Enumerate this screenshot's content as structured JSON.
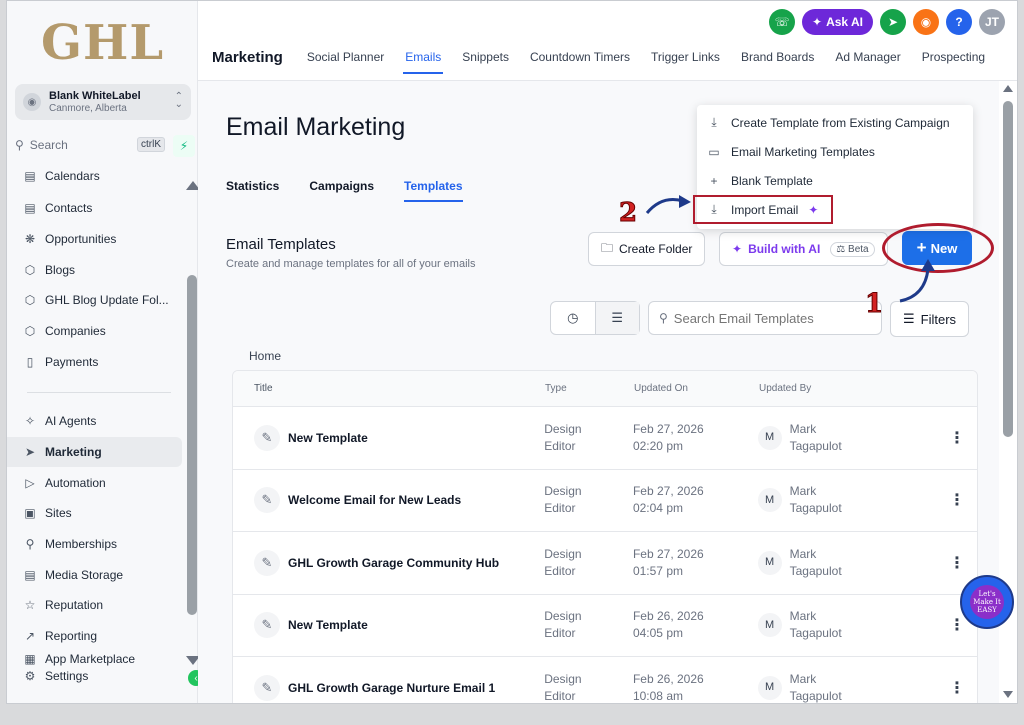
{
  "logo": "GHL",
  "account": {
    "name": "Blank WhiteLabel",
    "location": "Canmore, Alberta"
  },
  "sidebar": {
    "search_label": "Search",
    "search_shortcut": "ctrlK",
    "items_top": [
      {
        "label": "Calendars",
        "icon": "calendar-icon"
      },
      {
        "label": "Contacts",
        "icon": "contacts-icon"
      },
      {
        "label": "Opportunities",
        "icon": "opportunities-icon"
      },
      {
        "label": "Blogs",
        "icon": "blogs-icon"
      },
      {
        "label": "GHL Blog Update Fol...",
        "icon": "folder-icon"
      },
      {
        "label": "Companies",
        "icon": "companies-icon"
      },
      {
        "label": "Payments",
        "icon": "payments-icon"
      }
    ],
    "items_bottom": [
      {
        "label": "AI Agents",
        "icon": "ai-agents-icon"
      },
      {
        "label": "Marketing",
        "icon": "send-icon"
      },
      {
        "label": "Automation",
        "icon": "automation-icon"
      },
      {
        "label": "Sites",
        "icon": "sites-icon"
      },
      {
        "label": "Memberships",
        "icon": "memberships-icon"
      },
      {
        "label": "Media Storage",
        "icon": "media-icon"
      },
      {
        "label": "Reputation",
        "icon": "star-icon"
      },
      {
        "label": "Reporting",
        "icon": "chart-icon"
      },
      {
        "label": "App Marketplace",
        "icon": "grid-icon"
      }
    ],
    "settings": "Settings"
  },
  "header": {
    "ask_ai": "Ask AI",
    "user_initials": "JT",
    "help": "?",
    "section": "Marketing",
    "tabs": [
      "Social Planner",
      "Emails",
      "Snippets",
      "Countdown Timers",
      "Trigger Links",
      "Brand Boards",
      "Ad Manager",
      "Prospecting"
    ]
  },
  "main": {
    "title": "Email Marketing",
    "subtabs": [
      "Statistics",
      "Campaigns",
      "Templates"
    ],
    "section_title": "Email Templates",
    "section_subtitle": "Create and manage templates for all of your emails",
    "create_folder": "Create Folder",
    "build_ai": "Build with AI",
    "beta": "Beta",
    "new_button": "New",
    "search_placeholder": "Search Email Templates",
    "filters": "Filters",
    "breadcrumb": "Home"
  },
  "dropdown": [
    "Create Template from Existing Campaign",
    "Email Marketing Templates",
    "Blank Template",
    "Import Email"
  ],
  "table": {
    "headers": [
      "Title",
      "Type",
      "Updated On",
      "Updated By"
    ],
    "rows": [
      {
        "title": "New Template",
        "type1": "Design",
        "type2": "Editor",
        "date": "Feb 27, 2026",
        "time": "02:20 pm",
        "initial": "M",
        "by1": "Mark",
        "by2": "Tagapulot"
      },
      {
        "title": "Welcome Email for New Leads",
        "type1": "Design",
        "type2": "Editor",
        "date": "Feb 27, 2026",
        "time": "02:04 pm",
        "initial": "M",
        "by1": "Mark",
        "by2": "Tagapulot"
      },
      {
        "title": "GHL Growth Garage Community Hub",
        "type1": "Design",
        "type2": "Editor",
        "date": "Feb 27, 2026",
        "time": "01:57 pm",
        "initial": "M",
        "by1": "Mark",
        "by2": "Tagapulot"
      },
      {
        "title": "New Template",
        "type1": "Design",
        "type2": "Editor",
        "date": "Feb 26, 2026",
        "time": "04:05 pm",
        "initial": "M",
        "by1": "Mark",
        "by2": "Tagapulot"
      },
      {
        "title": "GHL Growth Garage Nurture Email 1",
        "type1": "Design",
        "type2": "Editor",
        "date": "Feb 26, 2026",
        "time": "10:08 am",
        "initial": "M",
        "by1": "Mark",
        "by2": "Tagapulot"
      }
    ]
  },
  "annotations": {
    "marker1": "1",
    "marker2": "2",
    "badge_text": "Let's Make It EASY"
  },
  "colors": {
    "primary": "#1d6fe8",
    "annotation_red": "#b01c2e",
    "ask_ai": "#6d28d9",
    "build_ai": "#7c3aed"
  }
}
